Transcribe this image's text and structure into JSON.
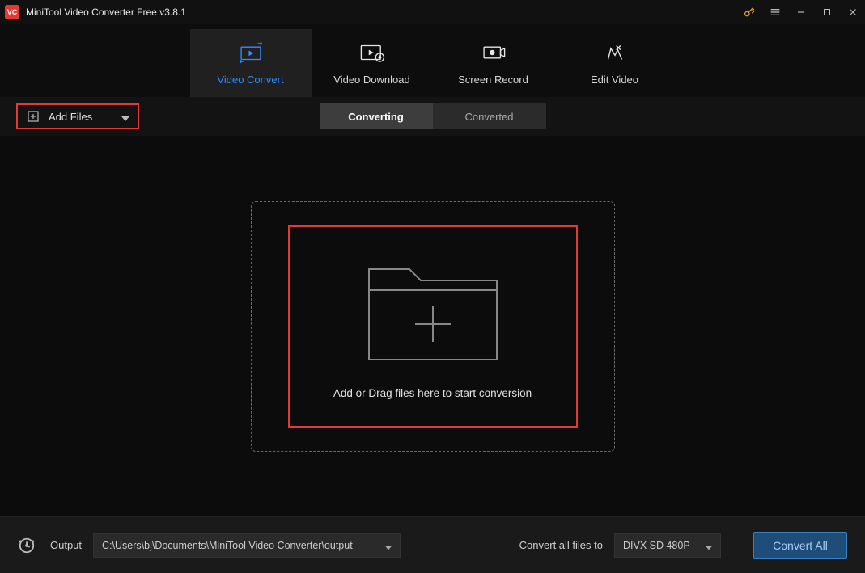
{
  "titlebar": {
    "title": "MiniTool Video Converter Free v3.8.1"
  },
  "nav": {
    "convert": "Video Convert",
    "download": "Video Download",
    "record": "Screen Record",
    "edit": "Edit Video"
  },
  "toolbar": {
    "add_files": "Add Files",
    "tab_converting": "Converting",
    "tab_converted": "Converted"
  },
  "dropzone": {
    "text": "Add or Drag files here to start conversion"
  },
  "footer": {
    "output_label": "Output",
    "output_path": "C:\\Users\\bj\\Documents\\MiniTool Video Converter\\output",
    "convert_all_label": "Convert all files to",
    "format_selected": "DIVX SD 480P",
    "convert_all_btn": "Convert All"
  }
}
